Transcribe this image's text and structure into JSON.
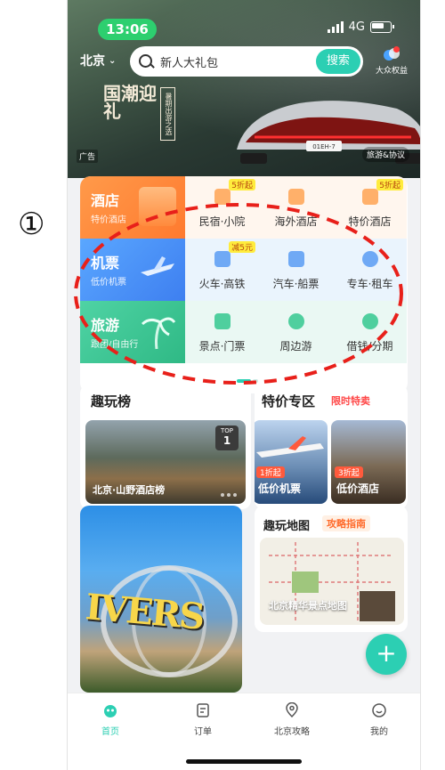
{
  "annotation": {
    "marker": "①"
  },
  "status_bar": {
    "time": "13:06",
    "network": "4G"
  },
  "header": {
    "city": "北京",
    "search": {
      "placeholder": "新人大礼包",
      "button": "搜索"
    },
    "perk_label": "大众权益"
  },
  "banner": {
    "logo_text": "国潮迎礼",
    "side_text": "暑期出游之选",
    "ad_tag": "广告",
    "link_text": "旅游&协议",
    "car_plate": "01EH-7"
  },
  "categories": {
    "hotel": {
      "title": "酒店",
      "subtitle": "特价酒店"
    },
    "flight": {
      "title": "机票",
      "subtitle": "低价机票"
    },
    "travel": {
      "title": "旅游",
      "subtitle": "跟团/自由行"
    },
    "row1": [
      {
        "label": "民宿·小院",
        "badge": "5折起"
      },
      {
        "label": "海外酒店",
        "badge": ""
      },
      {
        "label": "特价酒店",
        "badge": "5折起"
      }
    ],
    "row2": [
      {
        "label": "火车·高铁",
        "badge": "减5元"
      },
      {
        "label": "汽车·船票",
        "badge": ""
      },
      {
        "label": "专车·租车",
        "badge": ""
      }
    ],
    "row3": [
      {
        "label": "景点·门票",
        "badge": ""
      },
      {
        "label": "周边游",
        "badge": ""
      },
      {
        "label": "借钱/分期",
        "badge": ""
      }
    ]
  },
  "cards": {
    "qwb": {
      "title": "趣玩榜",
      "top_tag": "TOP",
      "rank": "1",
      "item": "北京·山野酒店榜"
    },
    "deals": {
      "title": "特价专区",
      "limited": "限时特卖",
      "items": [
        {
          "discount": "1折起",
          "name": "低价机票"
        },
        {
          "discount": "3折起",
          "name": "低价酒店"
        }
      ]
    },
    "map": {
      "title": "趣玩地图",
      "guide": "攻略指南",
      "label": "北京精华景点地图"
    },
    "universal_text": "IVERS"
  },
  "fab": {
    "label": "+"
  },
  "tabbar": {
    "items": [
      {
        "label": "首页",
        "icon": "home-icon"
      },
      {
        "label": "订单",
        "icon": "order-icon"
      },
      {
        "label": "北京攻略",
        "icon": "location-icon"
      },
      {
        "label": "我的",
        "icon": "profile-icon"
      }
    ]
  },
  "colors": {
    "accent": "#2ccfb3",
    "annotation": "#e8201a",
    "hotel": "#ff8a3d",
    "flight": "#3e8df0",
    "travel": "#3ccb98"
  }
}
